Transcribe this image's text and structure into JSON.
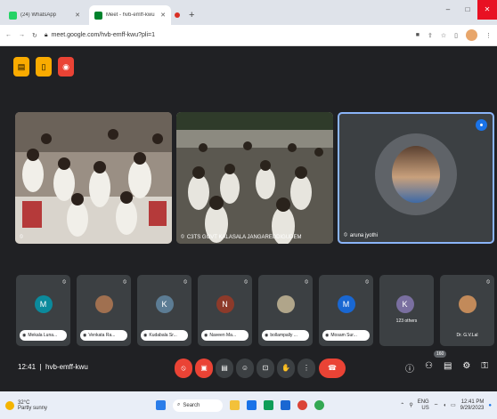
{
  "browser": {
    "tabs": [
      {
        "title": "(24) WhatsApp",
        "favicon_color": "#25d366",
        "active": false
      },
      {
        "title": "Meet - hvb-emff-kwu",
        "favicon_color": "#00832d",
        "active": true
      }
    ],
    "new_tab": "+",
    "url": "meet.google.com/hvb-emff-kwu?pli=1",
    "window_controls": [
      "–",
      "□",
      "✕"
    ]
  },
  "meet": {
    "top_buttons": [
      {
        "name": "notes-icon",
        "color": "#f9ab00",
        "glyph": "▤"
      },
      {
        "name": "activities-icon",
        "color": "#f9ab00",
        "glyph": "▯"
      },
      {
        "name": "recording-icon",
        "color": "#ea4335",
        "glyph": "◉"
      }
    ],
    "main_tiles": [
      {
        "name": "",
        "type": "classroom"
      },
      {
        "name": "C3TS GOVT KALASALA JANGAREDDIGUDEM",
        "type": "classroom"
      },
      {
        "name": "aruna jyothi",
        "type": "speaker"
      }
    ],
    "participants": [
      {
        "initial": "M",
        "name": "Mekala Luna...",
        "color": "#0b8a9c",
        "photo": false
      },
      {
        "initial": "",
        "name": "Venkata Ra...",
        "color": "#a07050",
        "photo": true
      },
      {
        "initial": "K",
        "name": "Kudabala Sr...",
        "color": "#5c7c94",
        "photo": false
      },
      {
        "initial": "N",
        "name": "Naveen Ma...",
        "color": "#8d3a2a",
        "photo": false
      },
      {
        "initial": "",
        "name": "bollampally ...",
        "color": "#b0a58a",
        "photo": true
      },
      {
        "initial": "M",
        "name": "Mosam Sur...",
        "color": "#1967d2",
        "photo": false
      }
    ],
    "others": {
      "label": "123 others",
      "chip": "K"
    },
    "last_tile": {
      "name": "Dr. G.V.Lal"
    },
    "time": "12:41",
    "meeting_code": "hvb-emff-kwu",
    "chat_badge": "160",
    "controls": [
      {
        "name": "mic-off-button",
        "glyph": "⦸",
        "red": true
      },
      {
        "name": "camera-off-button",
        "glyph": "▣",
        "red": true
      },
      {
        "name": "captions-button",
        "glyph": "▤",
        "red": false
      },
      {
        "name": "emoji-button",
        "glyph": "☺",
        "red": false
      },
      {
        "name": "present-button",
        "glyph": "⊡",
        "red": false
      },
      {
        "name": "raise-hand-button",
        "glyph": "✋",
        "red": false
      },
      {
        "name": "more-options-button",
        "glyph": "⋮",
        "red": false
      },
      {
        "name": "leave-call-button",
        "glyph": "☎",
        "red": true
      }
    ],
    "right_controls": [
      "ⓘ",
      "⚇",
      "▤",
      "⚙",
      "⚿"
    ]
  },
  "taskbar": {
    "temp": "32°C",
    "weather": "Partly sunny",
    "search": "Search",
    "lang": "ENG",
    "region": "US",
    "time": "12:41 PM",
    "date": "9/29/2023"
  }
}
